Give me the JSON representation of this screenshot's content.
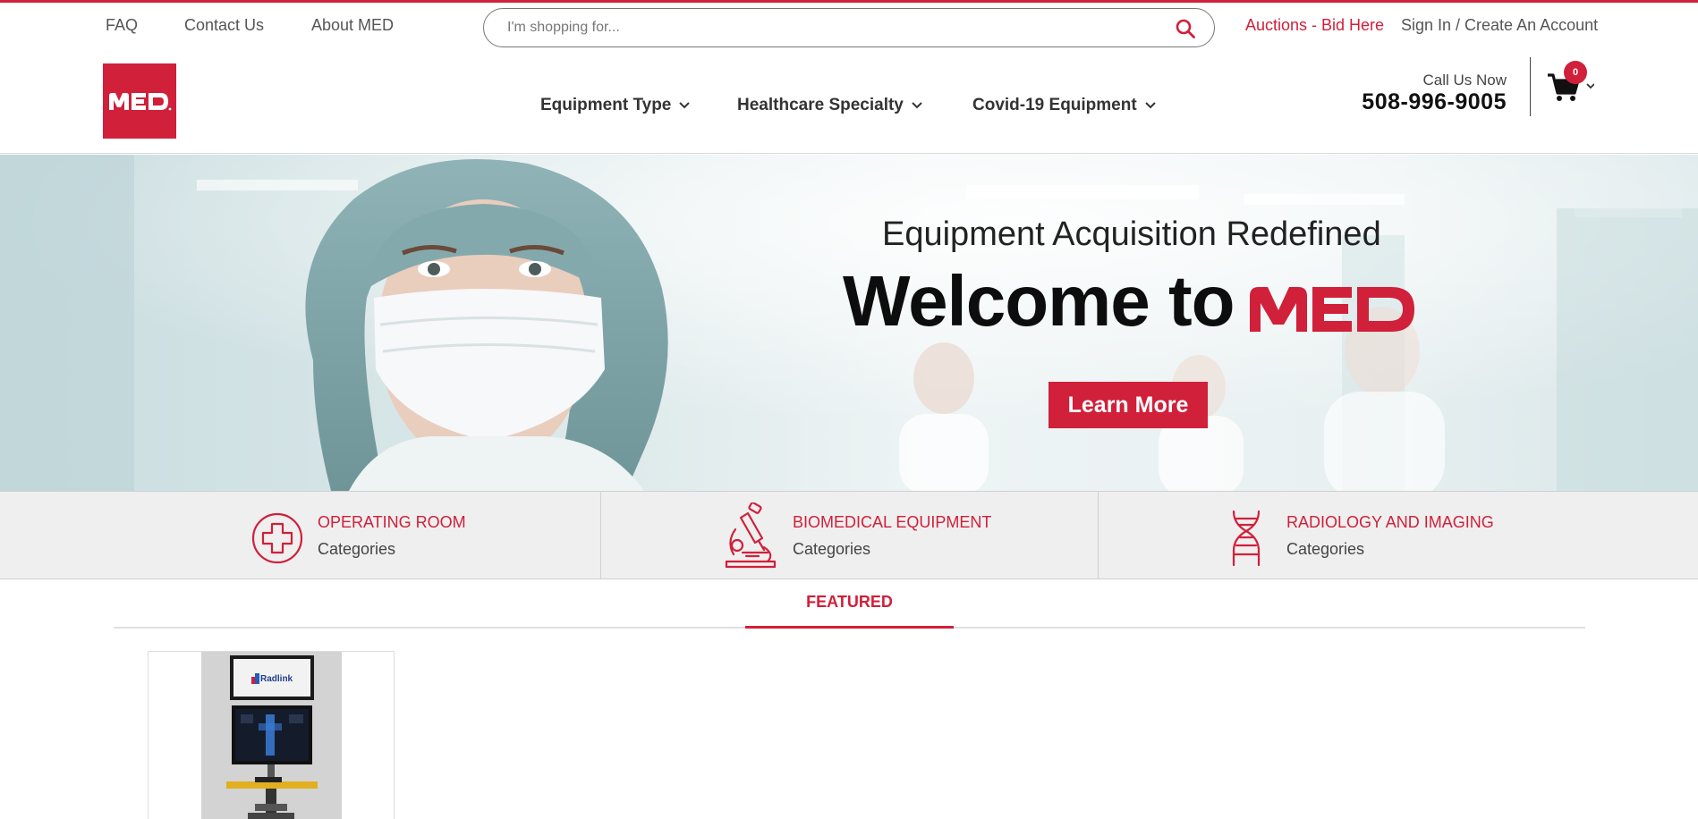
{
  "topbar": {
    "links": [
      "FAQ",
      "Contact Us",
      "About MED"
    ],
    "search_placeholder": "I'm shopping for...",
    "auctions_label": "Auctions - Bid Here",
    "signin_label": "Sign In / Create An Account"
  },
  "header": {
    "logo_text": "MED",
    "nav": [
      {
        "label": "Equipment Type"
      },
      {
        "label": "Healthcare Specialty"
      },
      {
        "label": "Covid-19 Equipment"
      }
    ],
    "call_label": "Call Us Now",
    "phone": "508-996-9005",
    "cart_count": "0"
  },
  "hero": {
    "subtitle": "Equipment Acquisition Redefined",
    "title": "Welcome to",
    "brand": "MED",
    "button_label": "Learn More"
  },
  "categories": [
    {
      "title": "OPERATING ROOM",
      "sub": "Categories",
      "icon": "medical-cross-icon"
    },
    {
      "title": "BIOMEDICAL EQUIPMENT",
      "sub": "Categories",
      "icon": "microscope-icon"
    },
    {
      "title": "RADIOLOGY AND IMAGING",
      "sub": "Categories",
      "icon": "dna-icon"
    }
  ],
  "featured": {
    "tab_label": "FEATURED",
    "product_brand": "Radlink"
  },
  "colors": {
    "accent": "#d0203a",
    "text_dark": "#111111",
    "category_bg": "#efefef"
  }
}
